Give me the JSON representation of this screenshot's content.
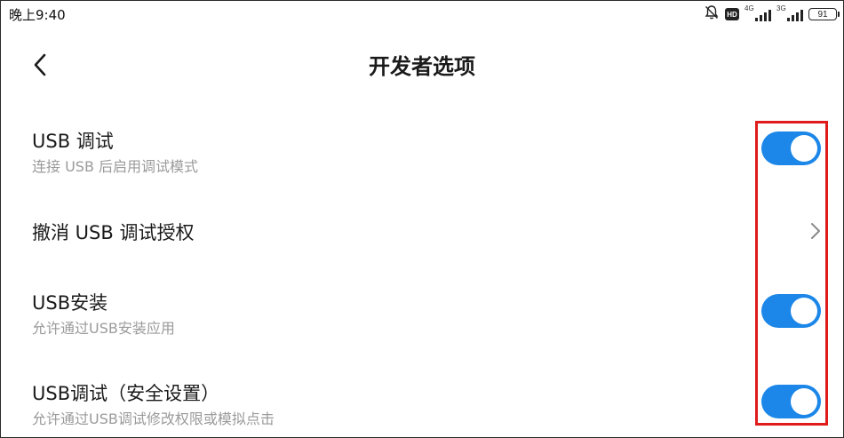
{
  "statusbar": {
    "time": "晚上9:40",
    "icons": [
      "bell-muted-icon",
      "hd-icon",
      "signal-4g-icon",
      "signal-3g-icon",
      "battery-icon"
    ],
    "hd_label": "HD",
    "sim1_network": "4G",
    "sim2_network": "3G",
    "battery_level": "91"
  },
  "header": {
    "back_icon": "chevron-left-icon",
    "title": "开发者选项"
  },
  "settings": [
    {
      "title": "USB 调试",
      "subtitle": "连接 USB 后启用调试模式",
      "control": "toggle",
      "enabled": true
    },
    {
      "title": "撤消 USB 调试授权",
      "subtitle": "",
      "control": "chevron-right-icon"
    },
    {
      "title": "USB安装",
      "subtitle": "允许通过USB安装应用",
      "control": "toggle",
      "enabled": true
    },
    {
      "title": "USB调试（安全设置）",
      "subtitle": "允许通过USB调试修改权限或模拟点击",
      "control": "toggle",
      "enabled": true
    }
  ],
  "colors": {
    "toggle_on": "#1c87e8",
    "highlight_box": "#e01b1b",
    "subtitle_text": "#9a9a9a"
  }
}
